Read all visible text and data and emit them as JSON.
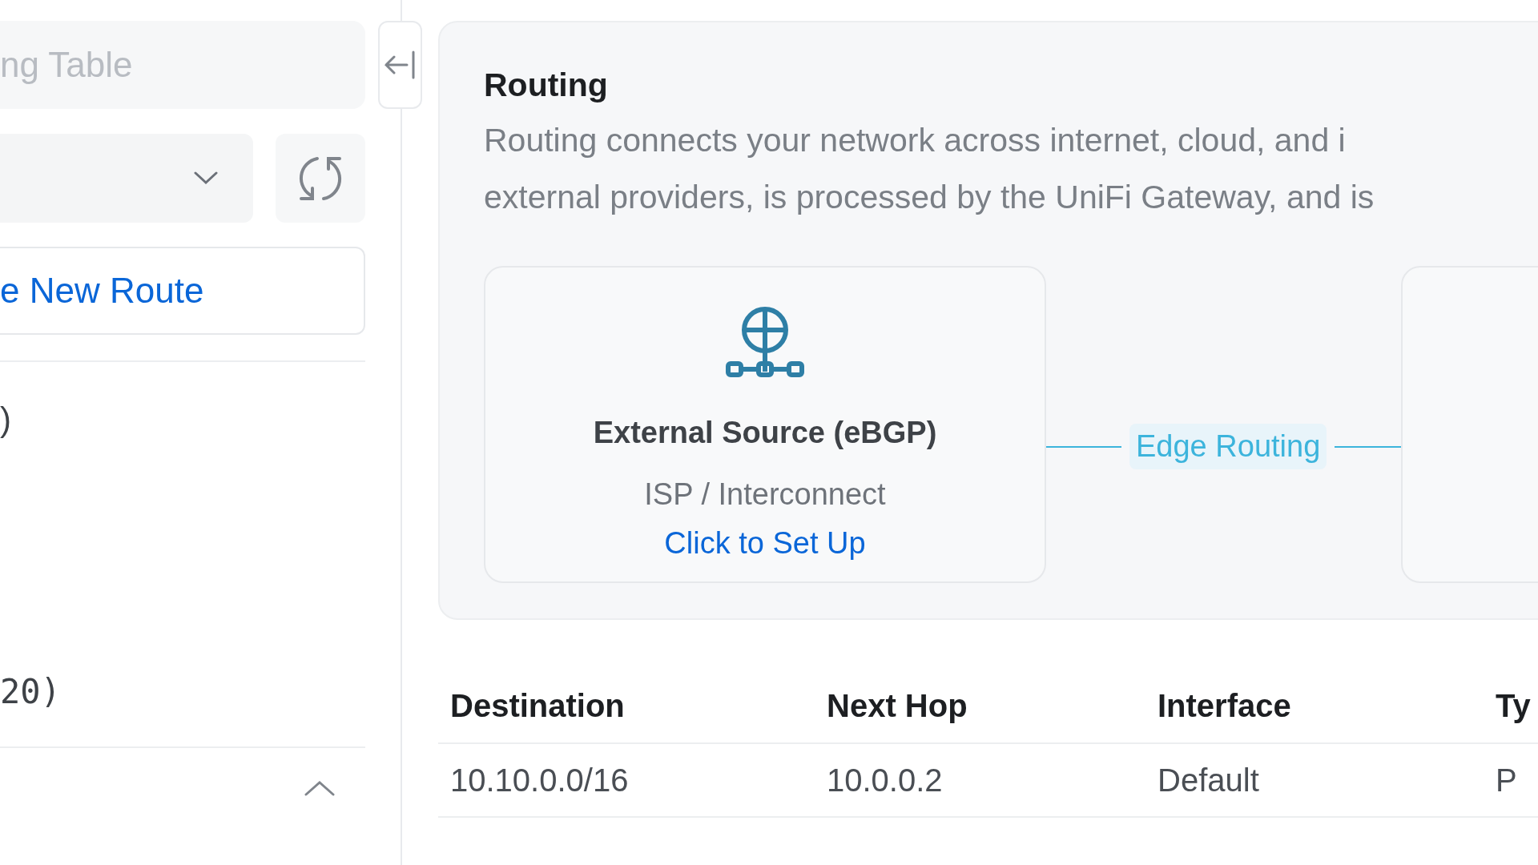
{
  "sidebar": {
    "search": {
      "placeholder": "ng Table"
    },
    "new_route_button": "e New Route",
    "items": [
      {
        "kind": "name",
        "text": ")"
      },
      {
        "kind": "code",
        "text": "20)"
      }
    ],
    "section": {
      "expanded": true
    }
  },
  "routing": {
    "title": "Routing",
    "description": [
      "Routing connects your network across internet, cloud, and i",
      "external providers, is processed by the UniFi Gateway, and is"
    ],
    "source_card": {
      "title": "External Source (eBGP)",
      "subtitle": "ISP / Interconnect",
      "link": "Click to Set Up"
    },
    "connector_label": "Edge Routing"
  },
  "table": {
    "columns": [
      "Destination",
      "Next Hop",
      "Interface",
      "Ty"
    ],
    "rows": [
      [
        "10.10.0.0/16",
        "10.0.0.2",
        "Default",
        "P"
      ]
    ]
  }
}
